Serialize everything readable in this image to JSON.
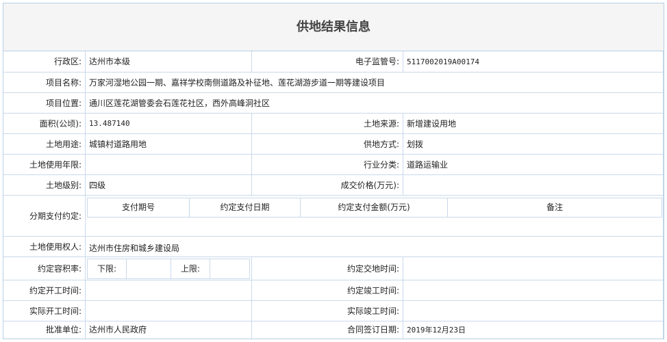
{
  "title": "供地结果信息",
  "labels": {
    "region": "行政区:",
    "supervision_no": "电子监管号:",
    "project_name": "项目名称:",
    "project_location": "项目位置:",
    "area": "面积(公顷):",
    "land_source": "土地来源:",
    "land_use": "土地用途:",
    "supply_method": "供地方式:",
    "use_years": "土地使用年限:",
    "industry": "行业分类:",
    "land_level": "土地级别:",
    "deal_price": "成交价格(万元):",
    "installment": "分期支付约定:",
    "land_user": "土地使用权人:",
    "plot_ratio": "约定容积率:",
    "delivery_time": "约定交地时间:",
    "start_time": "约定开工时间:",
    "completion_time": "约定竣工时间:",
    "actual_start": "实际开工时间:",
    "actual_completion": "实际竣工时间:",
    "approval_unit": "批准单位:",
    "contract_date": "合同签订日期:"
  },
  "values": {
    "region": "达州市本级",
    "supervision_no": "5117002019A00174",
    "project_name": "万家河湿地公园一期、嘉祥学校南侧道路及补征地、莲花湖游步道一期等建设项目",
    "project_location": "通川区莲花湖管委会石莲花社区，西外高峰洞社区",
    "area": "13.487140",
    "land_source": "新增建设用地",
    "land_use": "城镇村道路用地",
    "supply_method": "划拨",
    "use_years": "",
    "industry": "道路运输业",
    "land_level": "四级",
    "deal_price": "",
    "land_user": "达州市住房和城乡建设局",
    "delivery_time": "",
    "start_time": "",
    "completion_time": "",
    "actual_start": "",
    "actual_completion": "",
    "approval_unit": "达州市人民政府",
    "contract_date": "2019年12月23日"
  },
  "installment_table": {
    "headers": [
      "支付期号",
      "约定支付日期",
      "约定支付金额(万元)",
      "备注"
    ]
  },
  "plot_ratio": {
    "lower_label": "下限:",
    "lower_value": "",
    "upper_label": "上限:",
    "upper_value": ""
  }
}
